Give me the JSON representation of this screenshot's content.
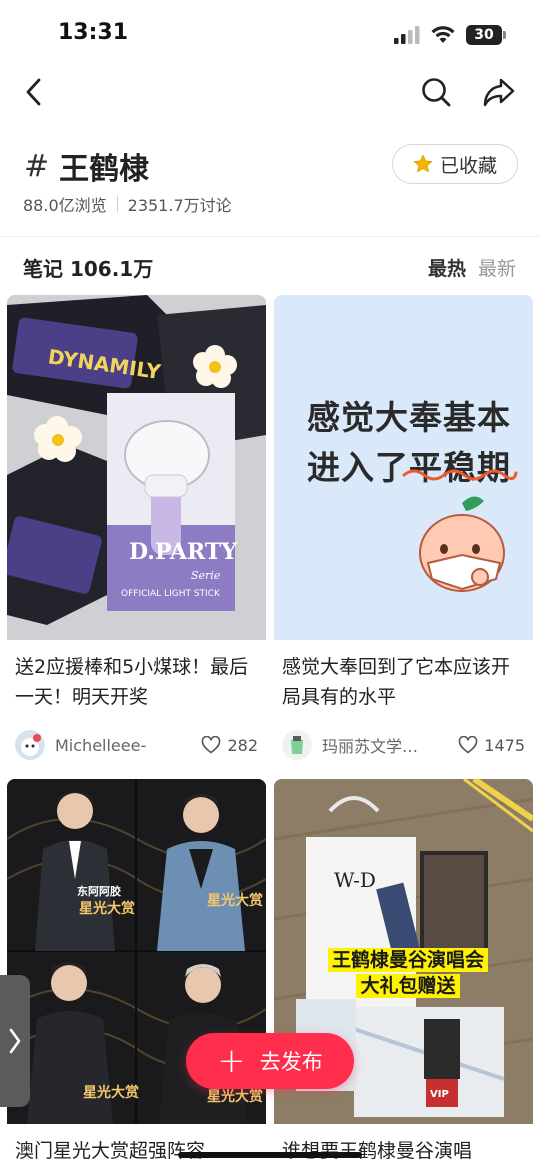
{
  "status_bar": {
    "time": "13:31",
    "battery": "30"
  },
  "topic": {
    "hash": "#",
    "name": "王鹤棣",
    "favorite_label": "已收藏",
    "views": "88.0亿浏览",
    "discussions": "2351.7万讨论"
  },
  "notes": {
    "count_label": "笔记 106.1万",
    "sort_hot": "最热",
    "sort_new": "最新"
  },
  "cards": [
    {
      "title": "送2应援棒和5小煤球！最后一天！明天开奖",
      "author": "Michelleee-",
      "likes": "282",
      "cover_texts": {
        "brand": "D.PARTY",
        "sub": "OFFICIAL LIGHT STICK",
        "sign": "Serie",
        "bag": "DYNAMILY"
      }
    },
    {
      "title": "感觉大奉回到了它本应该开局具有的水平",
      "author": "玛丽苏文学…",
      "likes": "1475",
      "cover_texts": {
        "line1": "感觉大奉基本",
        "line2": "进入了平稳期"
      }
    },
    {
      "title": "澳门星光大赏超强阵容",
      "cover_texts": {
        "badge": "东阿阿胶",
        "event": "星光大赏"
      }
    },
    {
      "title": "谁想要王鹤棣曼谷演唱",
      "cover_texts": {
        "line1": "王鹤棣曼谷演唱会",
        "line2": "大礼包赠送",
        "bag_logo": "W-D",
        "ticket": "VIP"
      }
    }
  ],
  "publish_button": {
    "plus": "+",
    "label": "去发布"
  },
  "colors": {
    "accent": "#ff2e4d",
    "star": "#f5b400"
  }
}
